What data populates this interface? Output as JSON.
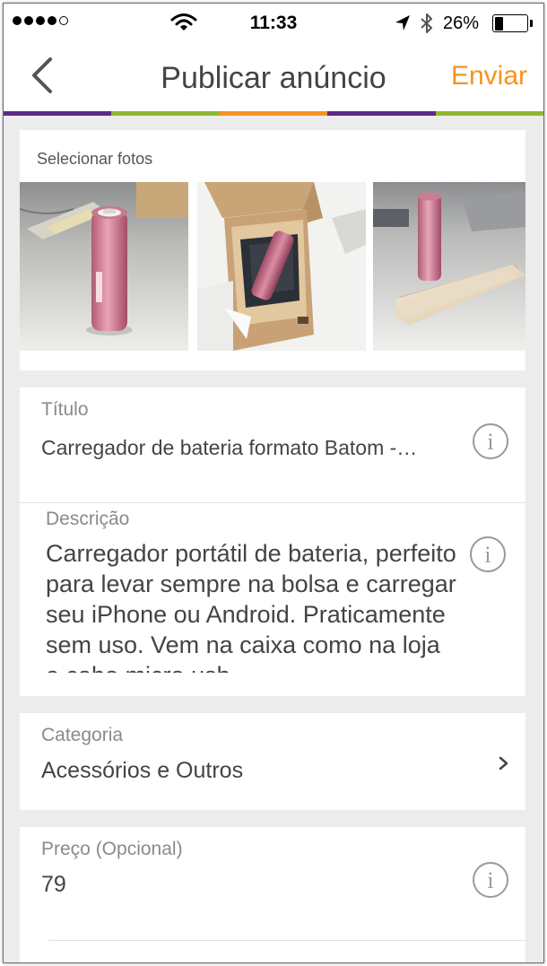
{
  "status_bar": {
    "signal_dots": 5,
    "signal_filled": 4,
    "time": "11:33",
    "battery_percent": "26%",
    "battery_level": 0.26
  },
  "nav": {
    "back_icon": "chevron-left-icon",
    "title": "Publicar anúncio",
    "send_label": "Enviar"
  },
  "colors": {
    "accent": "#f7931e",
    "stripe": [
      "#5b2a86",
      "#8fb82f",
      "#f7931e",
      "#5b2a86",
      "#8fb82f"
    ]
  },
  "photos": {
    "label": "Selecionar fotos",
    "items": [
      {
        "name": "pink-battery-on-desk-photo"
      },
      {
        "name": "battery-in-box-photo"
      },
      {
        "name": "battery-with-phone-photo"
      }
    ]
  },
  "form": {
    "title_label": "Título",
    "title_value": "Carregador de bateria formato Batom -…",
    "description_label": "Descrição",
    "description_value": "Carregador portátil de bateria, perfeito para levar sempre na bolsa e carregar seu iPhone ou Android. Praticamente sem uso. Vem na caixa como na loja e cabo micro usb.",
    "category_label": "Categoria",
    "category_value": "Acessórios e Outros",
    "price_label": "Preço (Opcional)",
    "price_value": "79"
  }
}
